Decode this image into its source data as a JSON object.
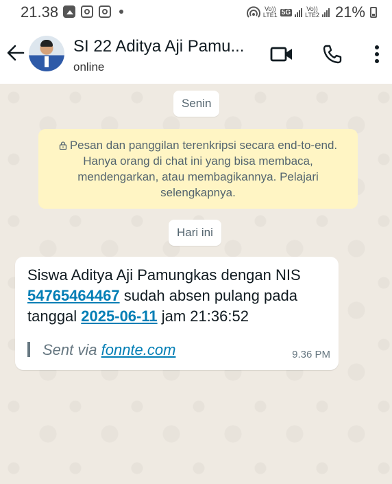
{
  "status_bar": {
    "time": "21.38",
    "volte1_top": "Vo))",
    "volte1_bottom": "LTE1",
    "network": "5G",
    "volte2_top": "Vo))",
    "volte2_bottom": "LTE2",
    "battery": "21%"
  },
  "header": {
    "title": "SI 22 Aditya Aji Pamu...",
    "status": "online"
  },
  "chat": {
    "day_chip_1": "Senin",
    "encryption_notice": "Pesan dan panggilan terenkripsi secara end-to-end. Hanya orang di chat ini yang bisa membaca, mendengarkan, atau membagikannya. Pelajari selengkapnya.",
    "day_chip_2": "Hari ini",
    "message": {
      "text_1": "Siswa Aditya Aji Pamungkas dengan NIS ",
      "nis": "54765464467",
      "text_2": " sudah absen pulang pada tanggal ",
      "date": "2025-06-11",
      "text_3": " jam 21:36:52",
      "sent_via_label": "Sent via ",
      "sent_via_link": "fonnte.com",
      "time": "9.36 PM"
    }
  }
}
